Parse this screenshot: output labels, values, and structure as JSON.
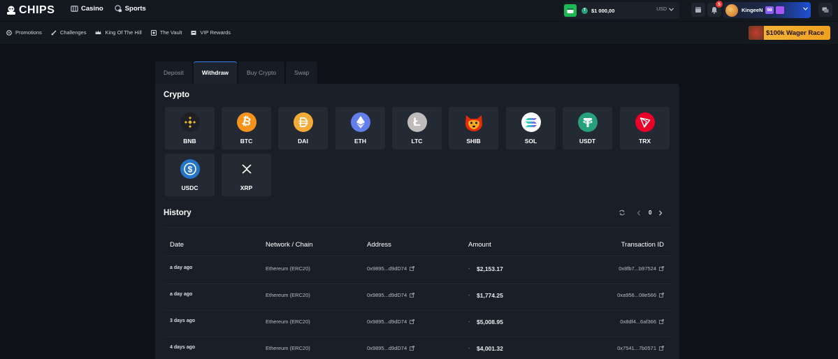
{
  "brand": {
    "name": "CHIPS"
  },
  "top_nav": [
    {
      "label": "Casino",
      "icon": "casino-icon"
    },
    {
      "label": "Sports",
      "icon": "sports-icon"
    }
  ],
  "wallet": {
    "balance": "$1 000,00",
    "currency": "USD"
  },
  "notifications": {
    "count": "5"
  },
  "user": {
    "name": "KingeeN",
    "level": "98"
  },
  "sub_nav": [
    {
      "label": "Promotions",
      "icon": "gear-icon"
    },
    {
      "label": "Challenges",
      "icon": "sword-icon"
    },
    {
      "label": "King Of The Hill",
      "icon": "crown-icon"
    },
    {
      "label": "The Vault",
      "icon": "vault-icon"
    },
    {
      "label": "VIP Rewards",
      "icon": "vip-icon"
    }
  ],
  "promo_banner": {
    "label": "$100k Wager Race"
  },
  "tabs": [
    {
      "label": "Deposit",
      "active": false
    },
    {
      "label": "Withdraw",
      "active": true
    },
    {
      "label": "Buy Crypto",
      "active": false
    },
    {
      "label": "Swap",
      "active": false
    }
  ],
  "crypto": {
    "title": "Crypto",
    "coins": [
      {
        "label": "BNB",
        "color": "#1e2026",
        "glyph": "#f3ba2f"
      },
      {
        "label": "BTC",
        "color": "#f7931a",
        "glyph": "#ffffff"
      },
      {
        "label": "DAI",
        "color": "#f5ac37",
        "glyph": "#ffffff"
      },
      {
        "label": "ETH",
        "color": "#627eea",
        "glyph": "#ffffff"
      },
      {
        "label": "LTC",
        "color": "#bfbbbb",
        "glyph": "#ffffff"
      },
      {
        "label": "SHIB",
        "color": "#e42d06",
        "glyph": "#f9a825"
      },
      {
        "label": "SOL",
        "color": "#ffffff",
        "glyph": "#9945ff"
      },
      {
        "label": "USDT",
        "color": "#26a17b",
        "glyph": "#ffffff"
      },
      {
        "label": "TRX",
        "color": "#eb0029",
        "glyph": "#ffffff"
      },
      {
        "label": "USDC",
        "color": "#2775ca",
        "glyph": "#ffffff"
      },
      {
        "label": "XRP",
        "color": "#23292f",
        "glyph": "#ffffff"
      }
    ]
  },
  "history": {
    "title": "History",
    "page": "0",
    "columns": {
      "date": "Date",
      "network": "Network / Chain",
      "address": "Address",
      "amount": "Amount",
      "txid": "Transaction ID"
    },
    "rows": [
      {
        "date": "a day ago",
        "network": "Ethereum (ERC20)",
        "address": "0x9895...d9dD74",
        "sign": "-",
        "amount": "$2,153.17",
        "txid": "0x8fb7...b97524"
      },
      {
        "date": "a day ago",
        "network": "Ethereum (ERC20)",
        "address": "0x9895...d9dD74",
        "sign": "-",
        "amount": "$1,774.25",
        "txid": "0xa956...08e566"
      },
      {
        "date": "3 days ago",
        "network": "Ethereum (ERC20)",
        "address": "0x9895...d9dD74",
        "sign": "-",
        "amount": "$5,008.95",
        "txid": "0x8df4...6af366"
      },
      {
        "date": "4 days ago",
        "network": "Ethereum (ERC20)",
        "address": "0x9895...d9dD74",
        "sign": "-",
        "amount": "$4,001.32",
        "txid": "0x7541...7b0571"
      }
    ]
  }
}
